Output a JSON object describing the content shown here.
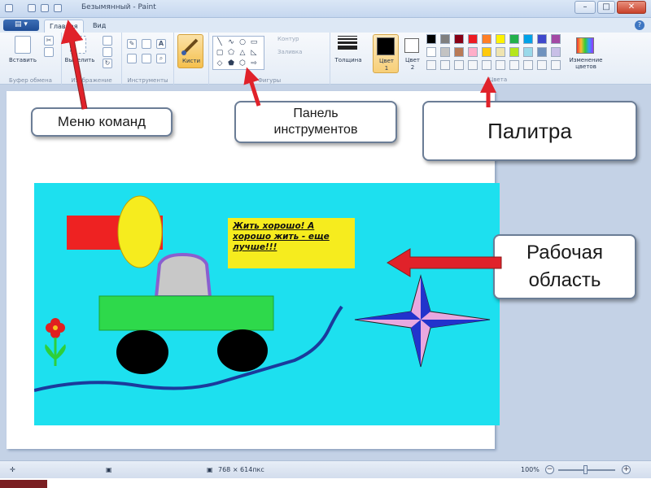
{
  "window": {
    "title": "Безымянный - Paint",
    "minimize": "–",
    "maximize": "□",
    "close": "✕"
  },
  "ribbon_tabs": {
    "file": "▤ ▾",
    "home": "Главная",
    "view": "Вид",
    "help": "?"
  },
  "ribbon": {
    "clipboard": {
      "paste": "Вставить",
      "group": "Буфер обмена"
    },
    "image": {
      "select": "Выделить",
      "group": "Изображение"
    },
    "tools": {
      "text_icon": "A",
      "group": "Инструменты"
    },
    "brushes": {
      "label": "Кисти"
    },
    "shapes": {
      "outline": "Контур",
      "fill": "Заливка",
      "group": "Фигуры"
    },
    "size": {
      "label": "Толщина"
    },
    "color1": {
      "label": "Цвет",
      "number": "1",
      "value": "#000000"
    },
    "color2": {
      "label": "Цвет",
      "number": "2",
      "value": "#ffffff"
    },
    "palette_group": "Цвета",
    "edit_colors": "Изменение цветов",
    "palette_row1": [
      "#000000",
      "#7f7f7f",
      "#880015",
      "#ed1c24",
      "#ff7f27",
      "#fff200",
      "#22b14c",
      "#00a2e8",
      "#3f48cc",
      "#a349a4"
    ],
    "palette_row2": [
      "#ffffff",
      "#c3c3c3",
      "#b97a57",
      "#ffaec9",
      "#ffc90e",
      "#efe4b0",
      "#b5e61d",
      "#99d9ea",
      "#7092be",
      "#c8bfe7"
    ]
  },
  "callouts": {
    "menu": "Меню команд",
    "toolbar": "Панель инструментов",
    "palette": "Палитра",
    "workarea": "Рабочая область"
  },
  "drawing": {
    "speech_text": "Жить хорошо! А хорошо жить - еще лучше!!!",
    "background": "#1de0ef"
  },
  "status": {
    "dimensions": "768 × 614пкс",
    "zoom": "100%",
    "zoom_out": "−",
    "zoom_in": "+"
  }
}
